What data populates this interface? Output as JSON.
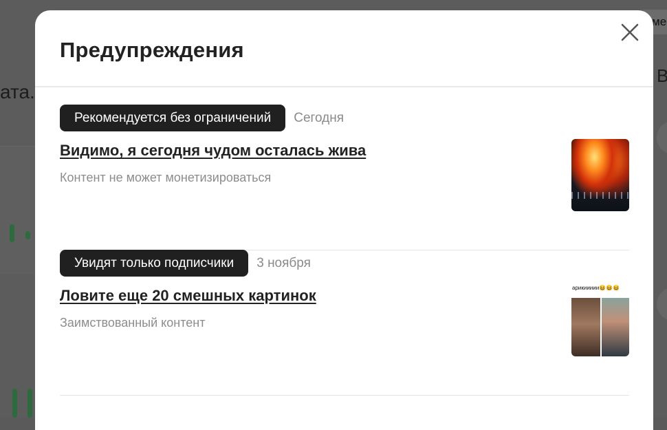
{
  "background": {
    "left_text": "ата.",
    "right_text": "В",
    "right_chip": "ме"
  },
  "modal": {
    "title": "Предупреждения",
    "close_icon": "close-icon"
  },
  "warnings": [
    {
      "tag": "Рекомендуется без ограничений",
      "date": "Сегодня",
      "title": "Видимо, я сегодня чудом осталась жива",
      "reason": "Контент не может монетизироваться",
      "thumbnail": "fire-photo"
    },
    {
      "tag": "Увидят только подписчики",
      "date": "3 ноября",
      "title": "Ловите еще 20 смешных картинок",
      "reason": "Заимствованный контент",
      "thumbnail": "meme-collage",
      "thumbnail_caption": "арикиииии😆😆😆"
    }
  ]
}
